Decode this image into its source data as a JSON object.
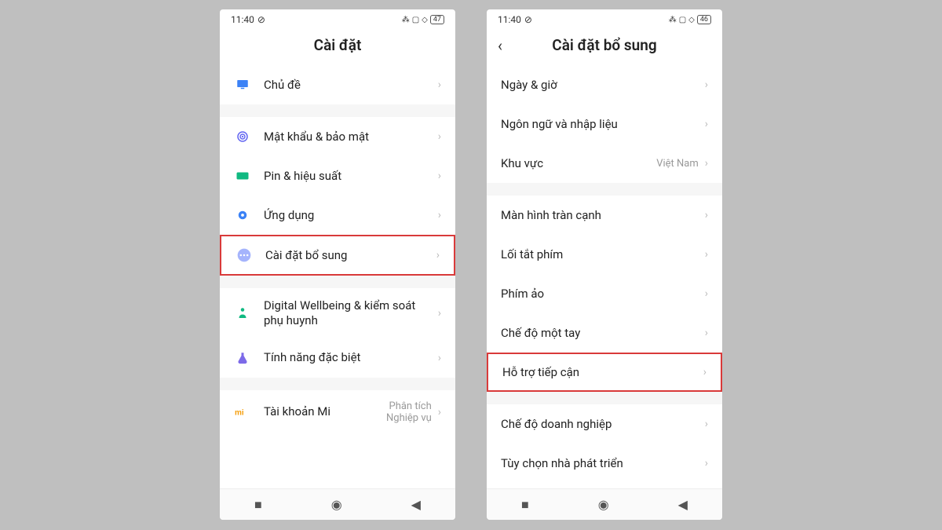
{
  "phone1": {
    "status": {
      "time": "11:40",
      "battery": "47"
    },
    "title": "Cài đặt",
    "rows": [
      {
        "icon": "theme",
        "label": "Chủ đề"
      },
      {
        "gap": true
      },
      {
        "icon": "security",
        "label": "Mật khẩu & bảo mật"
      },
      {
        "icon": "battery",
        "label": "Pin & hiệu suất"
      },
      {
        "icon": "apps",
        "label": "Ứng dụng"
      },
      {
        "icon": "additional",
        "label": "Cài đặt bổ sung",
        "highlight": true
      },
      {
        "gap": true
      },
      {
        "icon": "wellbeing",
        "label": "Digital Wellbeing & kiểm soát phụ huynh"
      },
      {
        "icon": "special",
        "label": "Tính năng đặc biệt"
      },
      {
        "gap": true
      },
      {
        "icon": "mi",
        "label": "Tài khoản Mi",
        "value": "Phân tích\nNghiệp vụ"
      }
    ]
  },
  "phone2": {
    "status": {
      "time": "11:40",
      "battery": "46"
    },
    "title": "Cài đặt bổ sung",
    "back": true,
    "rows": [
      {
        "label": "Ngày & giờ"
      },
      {
        "label": "Ngôn ngữ và nhập liệu"
      },
      {
        "label": "Khu vực",
        "value": "Việt Nam"
      },
      {
        "gap": true
      },
      {
        "label": "Màn hình tràn cạnh"
      },
      {
        "label": "Lối tắt phím"
      },
      {
        "label": "Phím ảo"
      },
      {
        "label": "Chế độ một tay"
      },
      {
        "label": "Hỗ trợ tiếp cận",
        "highlight": true
      },
      {
        "gap": true
      },
      {
        "label": "Chế độ doanh nghiệp"
      },
      {
        "label": "Tùy chọn nhà phát triển"
      }
    ]
  },
  "icons": {
    "theme": {
      "color": "#3b82f6",
      "shape": "monitor"
    },
    "security": {
      "color": "#6366f1",
      "shape": "target"
    },
    "battery": {
      "color": "#10b981",
      "shape": "rect"
    },
    "apps": {
      "color": "#3b82f6",
      "shape": "gear"
    },
    "additional": {
      "color": "#a5b4fc",
      "shape": "dots"
    },
    "wellbeing": {
      "color": "#10b981",
      "shape": "person"
    },
    "special": {
      "color": "#7c6ae8",
      "shape": "flask"
    },
    "mi": {
      "color": "#f59e0b",
      "shape": "mi"
    }
  }
}
